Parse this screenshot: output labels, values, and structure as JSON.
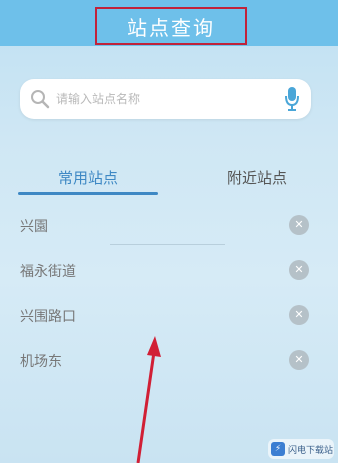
{
  "header": {
    "title": "站点查询"
  },
  "search": {
    "placeholder": "请输入站点名称",
    "icon": "search-icon",
    "mic_icon": "microphone-icon"
  },
  "tabs": [
    {
      "label": "常用站点",
      "active": true
    },
    {
      "label": "附近站点",
      "active": false
    }
  ],
  "stations": [
    {
      "name": "兴園"
    },
    {
      "name": "福永街道"
    },
    {
      "name": "兴围路口"
    },
    {
      "name": "机场东"
    }
  ],
  "delete_icon": "close-icon",
  "watermark": {
    "text": "闪电下载站"
  },
  "colors": {
    "header": "#6ec0ea",
    "accent": "#3e88c4",
    "highlight": "#c0223a",
    "arrow": "#d11f35"
  }
}
